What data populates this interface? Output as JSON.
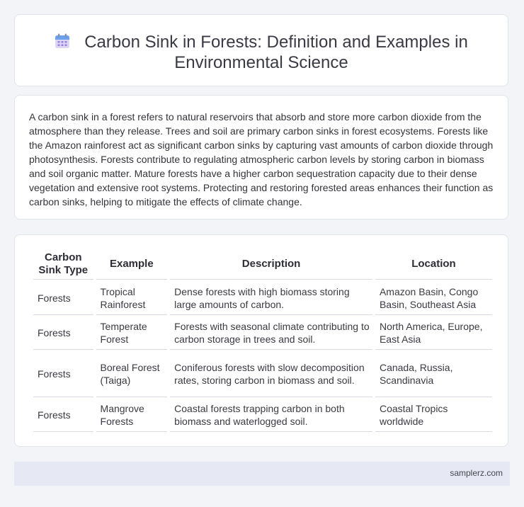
{
  "header": {
    "icon": "calendar-icon",
    "title": "Carbon Sink in Forests: Definition and Examples in Environmental Science"
  },
  "summary": "A carbon sink in a forest refers to natural reservoirs that absorb and store more carbon dioxide from the atmosphere than they release. Trees and soil are primary carbon sinks in forest ecosystems. Forests like the Amazon rainforest act as significant carbon sinks by capturing vast amounts of carbon dioxide through photosynthesis. Forests contribute to regulating atmospheric carbon levels by storing carbon in biomass and soil organic matter. Mature forests have a higher carbon sequestration capacity due to their dense vegetation and extensive root systems. Protecting and restoring forested areas enhances their function as carbon sinks, helping to mitigate the effects of climate change.",
  "table": {
    "headers": [
      "Carbon Sink Type",
      "Example",
      "Description",
      "Location"
    ],
    "rows": [
      [
        "Forests",
        "Tropical Rainforest",
        "Dense forests with high biomass storing large amounts of carbon.",
        "Amazon Basin, Congo Basin, Southeast Asia"
      ],
      [
        "Forests",
        "Temperate Forest",
        "Forests with seasonal climate contributing to carbon storage in trees and soil.",
        "North America, Europe, East Asia"
      ],
      [
        "Forests",
        "Boreal Forest (Taiga)",
        "Coniferous forests with slow decomposition rates, storing carbon in biomass and soil.",
        "Canada, Russia, Scandinavia"
      ],
      [
        "Forests",
        "Mangrove Forests",
        "Coastal forests trapping carbon in both biomass and waterlogged soil.",
        "Coastal Tropics worldwide"
      ]
    ]
  },
  "footer": {
    "site": "samplerz.com"
  }
}
